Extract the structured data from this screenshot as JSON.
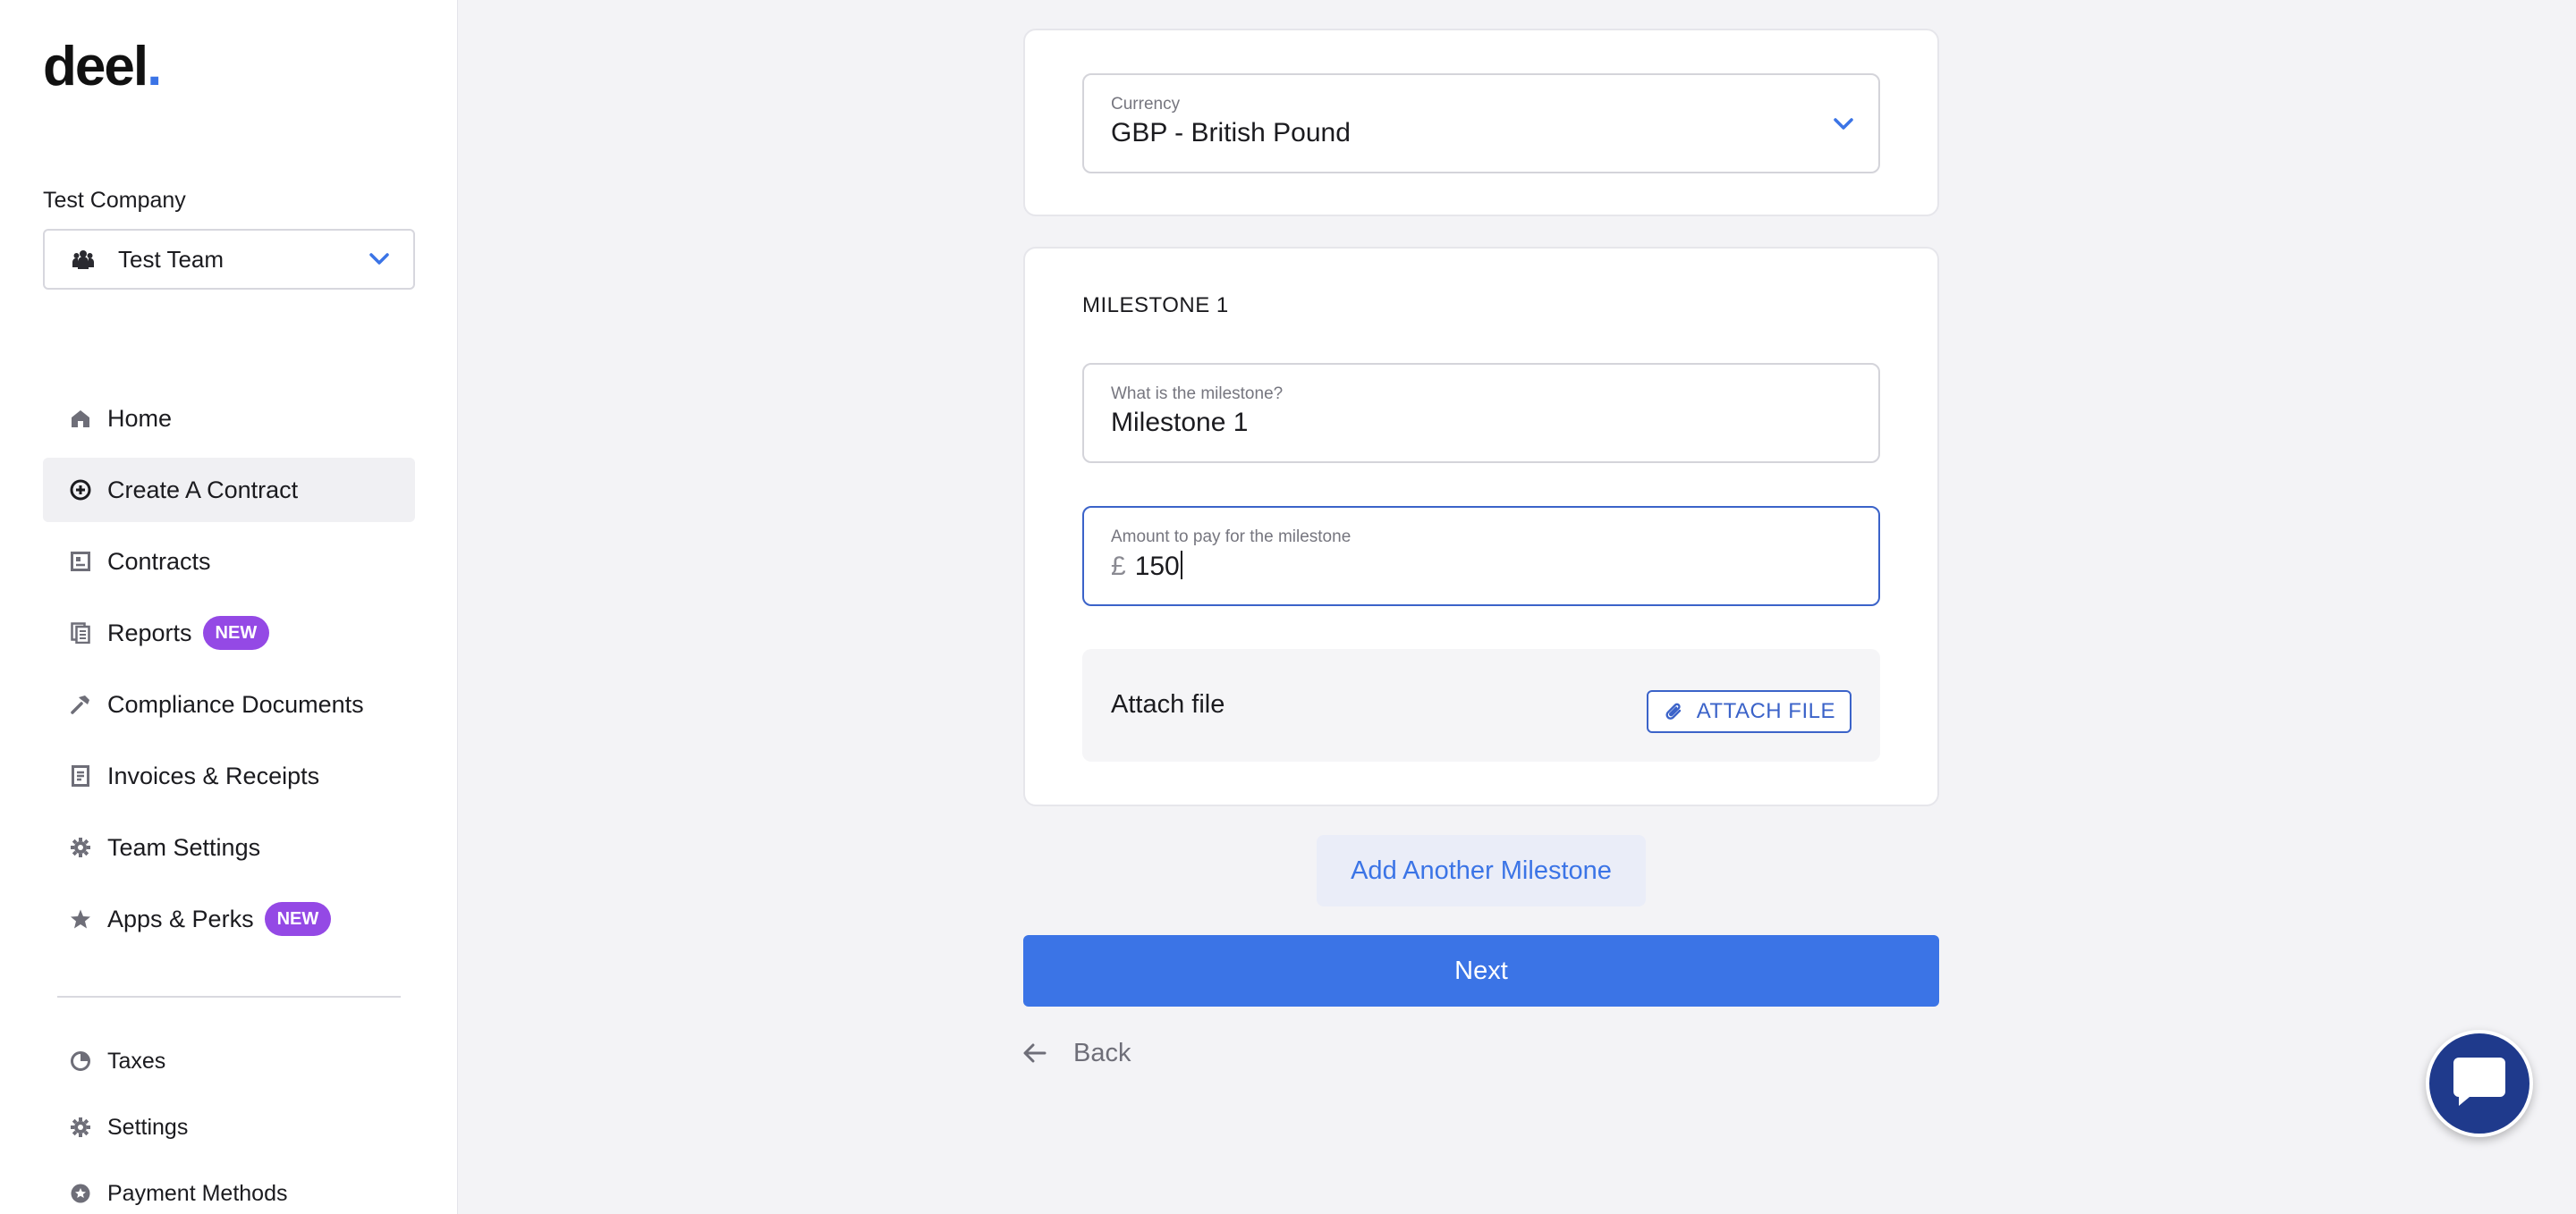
{
  "app": {
    "logo_text": "deel",
    "logo_dot": "."
  },
  "sidebar": {
    "company_label": "Test Company",
    "team_select": {
      "value": "Test Team",
      "icon": "team-icon"
    },
    "items": [
      {
        "label": "Home",
        "icon": "home-icon"
      },
      {
        "label": "Create A Contract",
        "icon": "plus-circle-icon",
        "active": true
      },
      {
        "label": "Contracts",
        "icon": "contracts-icon"
      },
      {
        "label": "Reports",
        "icon": "reports-icon",
        "badge": "NEW"
      },
      {
        "label": "Compliance Documents",
        "icon": "hammer-icon"
      },
      {
        "label": "Invoices & Receipts",
        "icon": "invoice-icon"
      },
      {
        "label": "Team Settings",
        "icon": "gear-icon"
      },
      {
        "label": "Apps & Perks",
        "icon": "star-icon",
        "badge": "NEW"
      }
    ],
    "secondary_items": [
      {
        "label": "Taxes",
        "icon": "pie-chart-icon"
      },
      {
        "label": "Settings",
        "icon": "gear-icon"
      },
      {
        "label": "Payment Methods",
        "icon": "payment-icon"
      }
    ]
  },
  "form": {
    "currency": {
      "label": "Currency",
      "value": "GBP - British Pound"
    },
    "milestone": {
      "title": "MILESTONE 1",
      "name_field": {
        "label": "What is the milestone?",
        "value": "Milestone 1"
      },
      "amount_field": {
        "label": "Amount to pay for the milestone",
        "currency_symbol": "£",
        "value": "150"
      },
      "attach": {
        "label": "Attach file",
        "button_label": "ATTACH FILE"
      }
    },
    "add_milestone_label": "Add Another Milestone",
    "next_label": "Next",
    "back_label": "Back"
  },
  "colors": {
    "accent": "#3b74e6",
    "badge": "#9449e5",
    "chat": "#1f3a8c"
  }
}
